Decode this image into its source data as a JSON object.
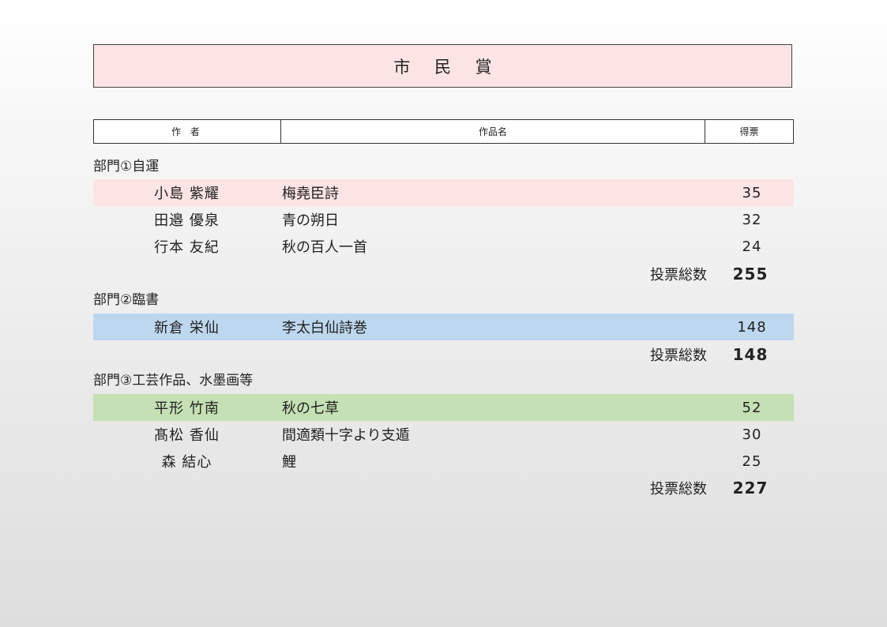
{
  "title": "市 民 賞",
  "headers": {
    "author": "作 者",
    "work": "作品名",
    "votes": "得票"
  },
  "total_label": "投票総数",
  "sections": [
    {
      "label": "部門①自運",
      "rows": [
        {
          "author": "小島  紫耀",
          "work": "梅堯臣詩",
          "votes": "35"
        },
        {
          "author": "田邉  優泉",
          "work": "青の朔日",
          "votes": "32"
        },
        {
          "author": "行本  友紀",
          "work": "秋の百人一首",
          "votes": "24"
        }
      ],
      "total": "255"
    },
    {
      "label": "部門②臨書",
      "rows": [
        {
          "author": "新倉  栄仙",
          "work": "李太白仙詩巻",
          "votes": "148"
        }
      ],
      "total": "148"
    },
    {
      "label": "部門③工芸作品、水墨画等",
      "rows": [
        {
          "author": "平形  竹南",
          "work": "秋の七草",
          "votes": "52"
        },
        {
          "author": "髙松  香仙",
          "work": "間適類十字より支遁",
          "votes": "30"
        },
        {
          "author": "森  結心",
          "work": "鯉",
          "votes": "25"
        }
      ],
      "total": "227"
    }
  ],
  "colors": {
    "section1_highlight": "#fde4e4",
    "section2_highlight": "#bdd7ee",
    "section3_highlight": "#c5e0b4",
    "title_background": "#fde4e4"
  }
}
